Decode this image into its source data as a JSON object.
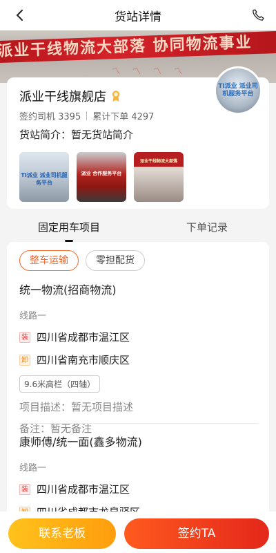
{
  "nav": {
    "title": "货站详情",
    "back_icon": "chevron-left-icon",
    "phone_icon": "phone-icon"
  },
  "banner": {
    "slogan": "派业干线物流大部落 协同物流事业",
    "deco": "〽〽〽〽"
  },
  "shop": {
    "name": "派业干线旗舰店",
    "badge_icon": "award-icon",
    "drivers": "签约司机 3395",
    "orders": "累计下单 4297",
    "intro": "货站简介：暂无货站简介",
    "avatar_text": "TI派业 派业司机服务平台",
    "photos": [
      {
        "label": "TI派业 派业司机服务平台"
      },
      {
        "label": "派业 合作服务平台"
      },
      {
        "label": "派业干线物流大部落"
      }
    ]
  },
  "tabs": [
    {
      "label": "固定用车项目",
      "active": true
    },
    {
      "label": "下单记录",
      "active": false
    }
  ],
  "project_types": [
    {
      "label": "整车运输",
      "active": true
    },
    {
      "label": "零担配货",
      "active": false
    }
  ],
  "projects": [
    {
      "title": "统一物流(招商物流)",
      "route_label": "线路一",
      "load_tag": "装",
      "load": "四川省成都市温江区",
      "unload_tag": "卸",
      "unload": "四川省南充市顺庆区",
      "spec": "9.6米高栏（四轴）",
      "desc": "项目描述：暂无项目描述",
      "note": "备注：暂无备注"
    },
    {
      "title": "康师傅/统一面(鑫多物流)",
      "route_label": "线路一",
      "load_tag": "装",
      "load": "四川省成都市温江区",
      "unload_tag": "卸",
      "unload": "四川省成都市龙泉驿区"
    }
  ],
  "actions": {
    "contact": "联系老板",
    "sign": "签约TA"
  },
  "colors": {
    "accent": "#f06a2d",
    "sign_button": "#e4271a",
    "contact_button": "#ffb315"
  }
}
